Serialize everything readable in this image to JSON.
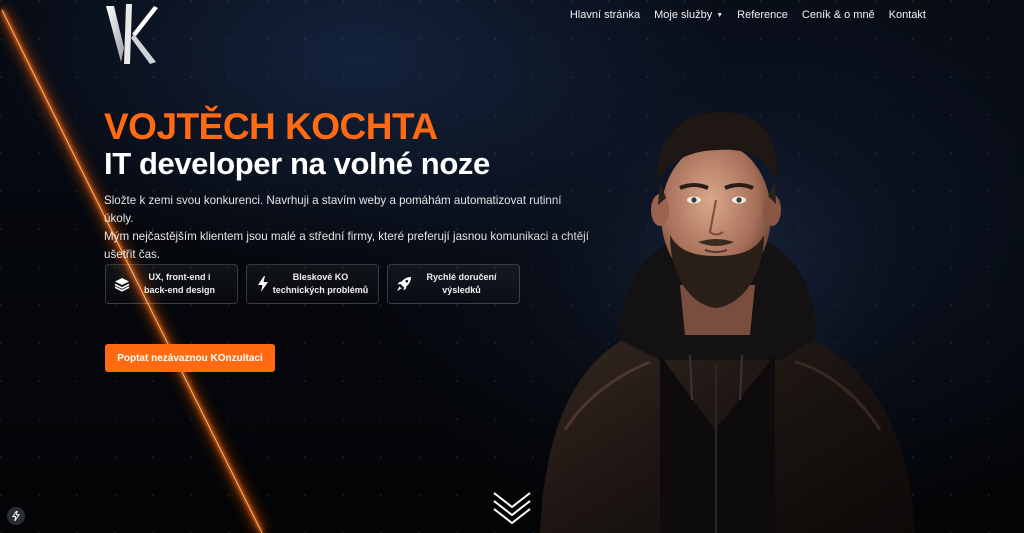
{
  "brand": {
    "logo_icon": "vk-monogram-logo"
  },
  "nav": {
    "items": [
      {
        "label": "Hlavní stránka"
      },
      {
        "label": "Moje služby",
        "has_dropdown": true
      },
      {
        "label": "Reference"
      },
      {
        "label": "Ceník & o mně"
      },
      {
        "label": "Kontakt"
      }
    ]
  },
  "hero": {
    "name": "VOJTĚCH KOCHTA",
    "tagline": "IT developer na volné noze",
    "description_line1": "Složte k zemi svou konkurenci. Navrhuji a stavím weby a pomáhám automatizovat rutinní úkoly.",
    "description_line2": "Mým nejčastějším klientem jsou malé a střední firmy, které preferují jasnou komunikaci a chtějí",
    "description_line3": "ušetřit čas.",
    "features": [
      {
        "icon": "layers-icon",
        "line1": "UX, front-end i",
        "line2": "back-end design"
      },
      {
        "icon": "lightning-icon",
        "line1": "Bleskové KO",
        "line2": "technických problémů"
      },
      {
        "icon": "rocket-icon",
        "line1": "Rychlé doručení",
        "line2": "výsledků"
      }
    ],
    "cta_label": "Poptat nezávaznou KOnzultaci"
  },
  "colors": {
    "accent": "#ff6a13",
    "background": "#05070b"
  }
}
